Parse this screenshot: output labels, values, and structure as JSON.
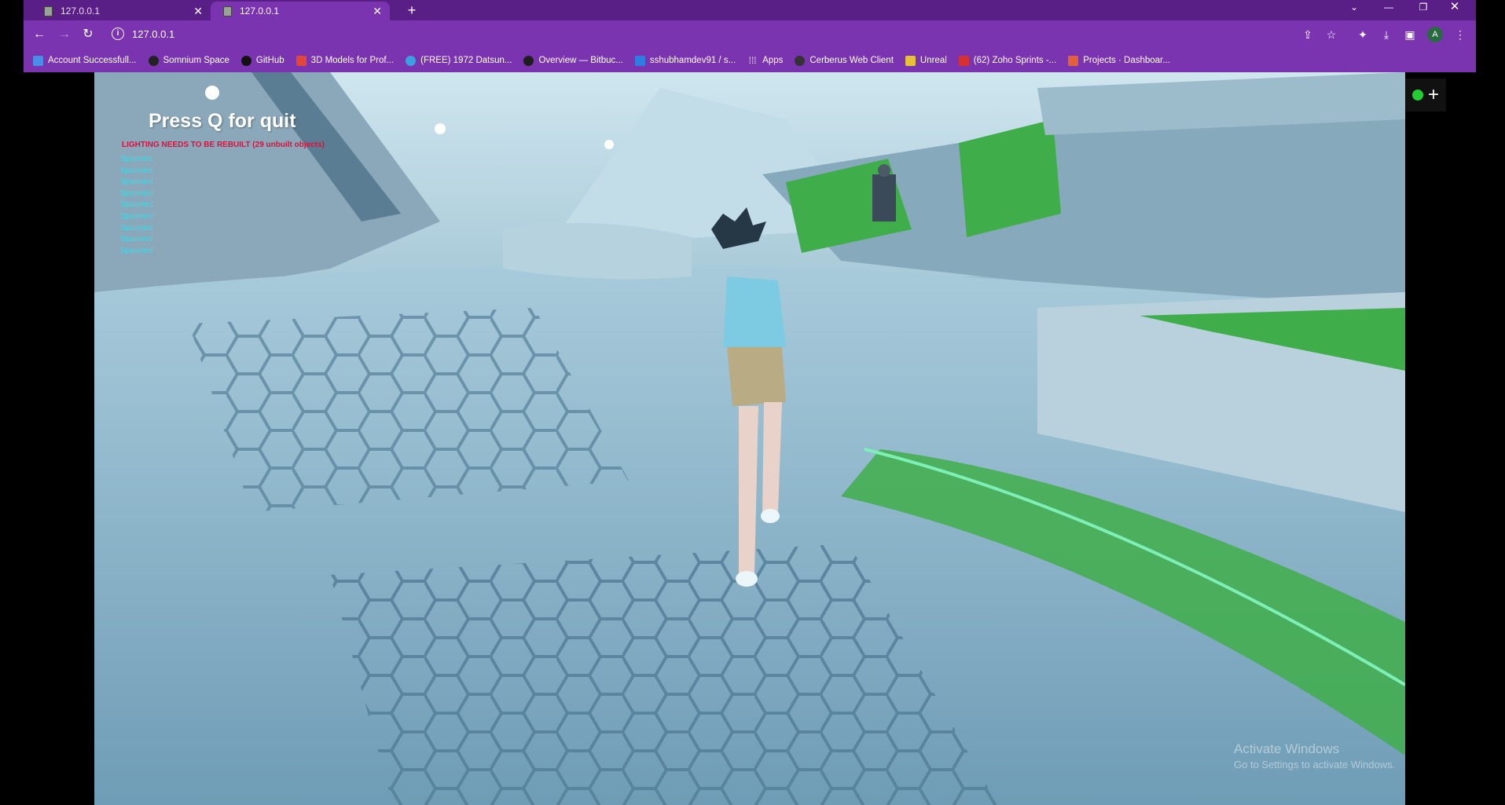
{
  "browser": {
    "tabs": [
      {
        "title": "127.0.0.1",
        "active": false
      },
      {
        "title": "127.0.0.1",
        "active": true
      }
    ],
    "new_tab_icon": "plus-icon",
    "url": "127.0.0.1",
    "tab_close_glyph": "✕",
    "window_controls": [
      "chevron-down-icon",
      "minimize-icon",
      "restore-icon",
      "close-icon"
    ],
    "toolbar_icons": [
      "share-icon",
      "star-icon",
      "extensions-icon",
      "download-icon",
      "sidebar-icon",
      "profile-avatar",
      "more-icon"
    ],
    "profile_initial": "A",
    "bookmarks": [
      {
        "label": "Account Successfull...",
        "color": "#4a8ee8"
      },
      {
        "label": "Somnium Space",
        "color": "#222222"
      },
      {
        "label": "GitHub",
        "color": "#111111"
      },
      {
        "label": "3D Models for Prof...",
        "color": "#e2453a"
      },
      {
        "label": "(FREE) 1972 Datsun...",
        "color": "#3aa0e0"
      },
      {
        "label": "Overview — Bitbuc...",
        "color": "#1e1e1e"
      },
      {
        "label": "sshubhamdev91 / s...",
        "color": "#2f7de0"
      },
      {
        "label": "Apps",
        "color": "#7a34b0"
      },
      {
        "label": "Cerberus Web Client",
        "color": "#333333"
      },
      {
        "label": "Unreal",
        "color": "#e7c13a"
      },
      {
        "label": "(62) Zoho Sprints -...",
        "color": "#d63030"
      },
      {
        "label": "Projects · Dashboar...",
        "color": "#e2603a"
      }
    ],
    "colors": {
      "tabstrip": "#5a1f86",
      "toolbar": "#7a34b0"
    }
  },
  "game": {
    "quit_hint": "Press Q for quit",
    "lighting_warning": "LIGHTING NEEDS TO BE REBUILT (29 unbuilt objects)",
    "spawned_messages": [
      "Spawned",
      "Spawned",
      "Spawned",
      "Spawned",
      "Spawned",
      "Spawned",
      "Spawned",
      "Spawned",
      "Spawned"
    ],
    "watermark_title": "Activate Windows",
    "watermark_subtitle": "Go to Settings to activate Windows.",
    "colors": {
      "warning": "#d8123d",
      "spawned": "#3fd7e6",
      "grass": "#3fae4a"
    }
  },
  "side_widget": {
    "status_color": "#22cc33",
    "add_icon": "plus-icon",
    "add_glyph": "+"
  }
}
